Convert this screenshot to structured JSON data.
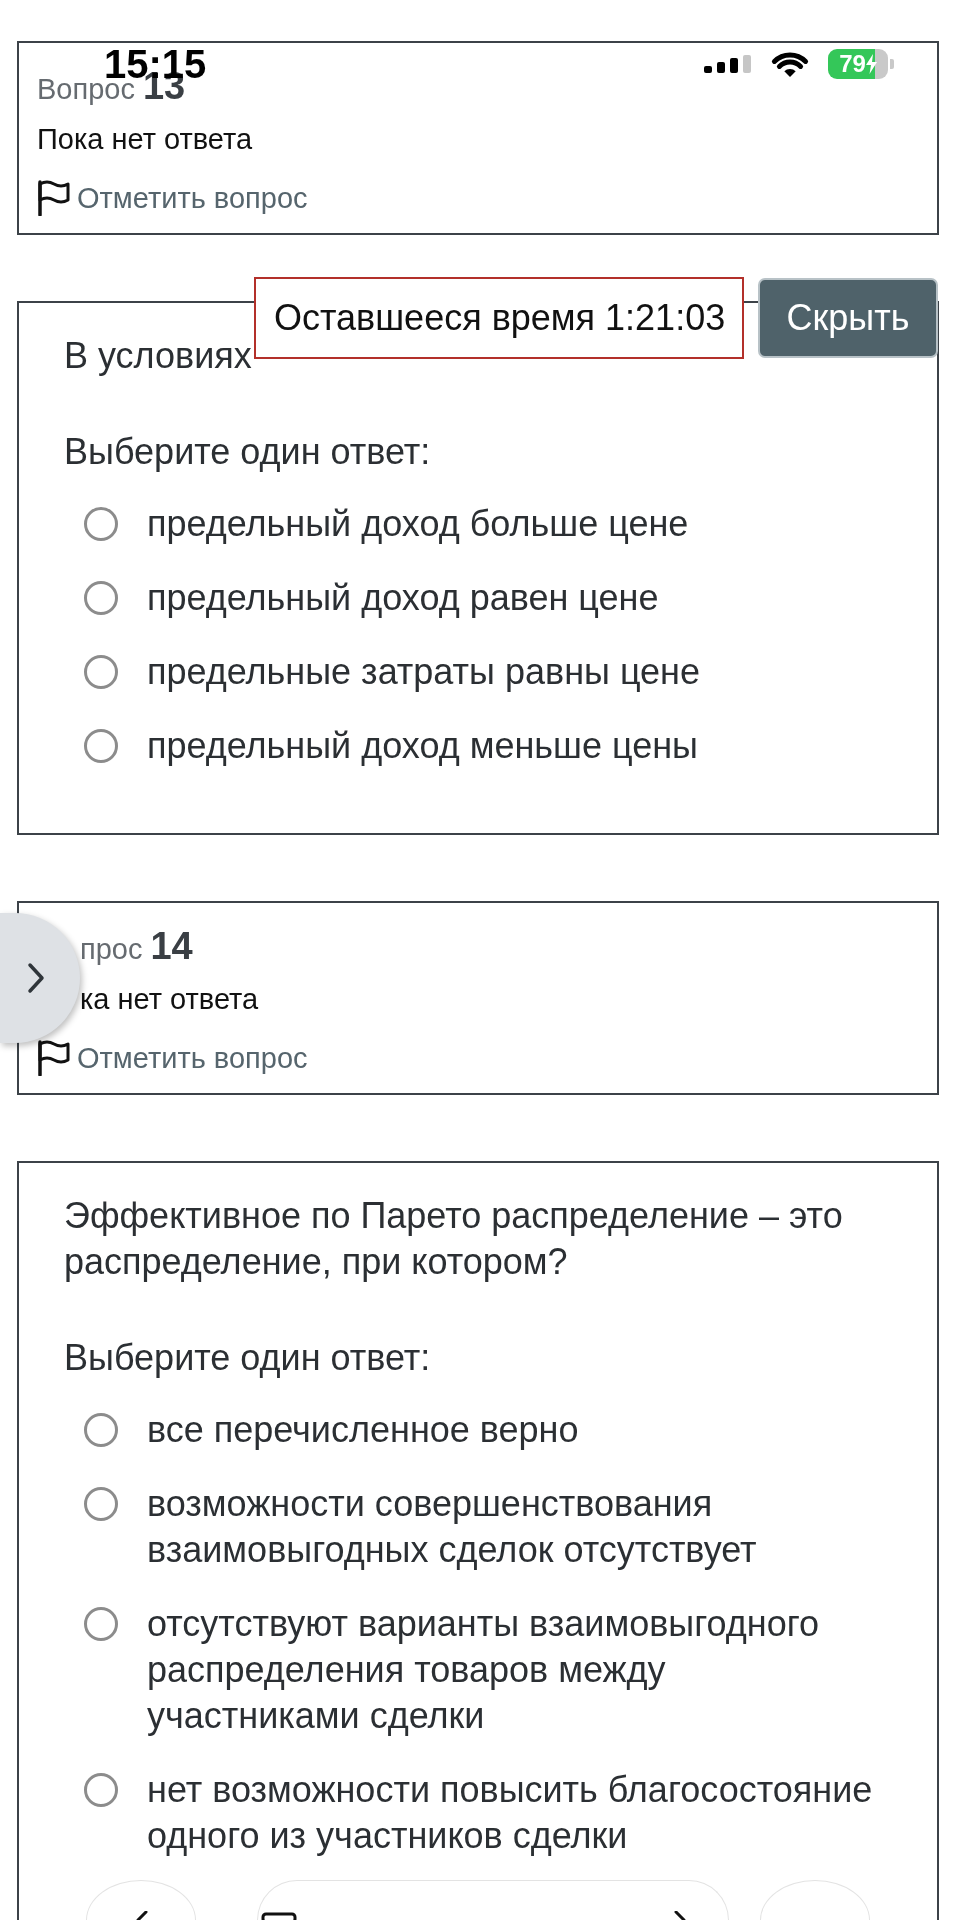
{
  "status_bar": {
    "time": "15:15",
    "battery": "79",
    "charging": true
  },
  "timer": {
    "text": "Оставшееся время 1:21:03",
    "hide_button": "Скрыть"
  },
  "drawer_toggle": {
    "expanded": false
  },
  "questions": [
    {
      "info": {
        "label": "Вопрос",
        "number": "13",
        "status": "Пока нет ответа",
        "flag_link": "Отметить вопрос",
        "flagged": false
      },
      "content": {
        "text": "В условиях",
        "prompt": "Выберите один ответ:",
        "options": [
          {
            "label": "предельный доход больше цене",
            "selected": false
          },
          {
            "label": "предельный доход равен цене",
            "selected": false
          },
          {
            "label": "предельные затраты равны цене",
            "selected": false
          },
          {
            "label": "предельный доход меньше цены",
            "selected": false
          }
        ]
      }
    },
    {
      "info": {
        "label": "прос",
        "number": "14",
        "status": "ка нет ответа",
        "flag_link": "Отметить вопрос",
        "flagged": false
      },
      "content": {
        "text": "Эффективное по Парето распределение – это распределение, при котором?",
        "prompt": "Выберите один ответ:",
        "options": [
          {
            "label": "все перечисленное верно",
            "selected": false
          },
          {
            "label": "возможности совершенствования взаимовыгодных сделок отсутствует",
            "selected": false
          },
          {
            "label": "отсутствуют варианты взаимовыгодного распределения товаров между участниками сделки",
            "selected": false
          },
          {
            "label": "нет возможности повысить благосостояние одного из участников сделки",
            "selected": false
          }
        ]
      }
    }
  ]
}
